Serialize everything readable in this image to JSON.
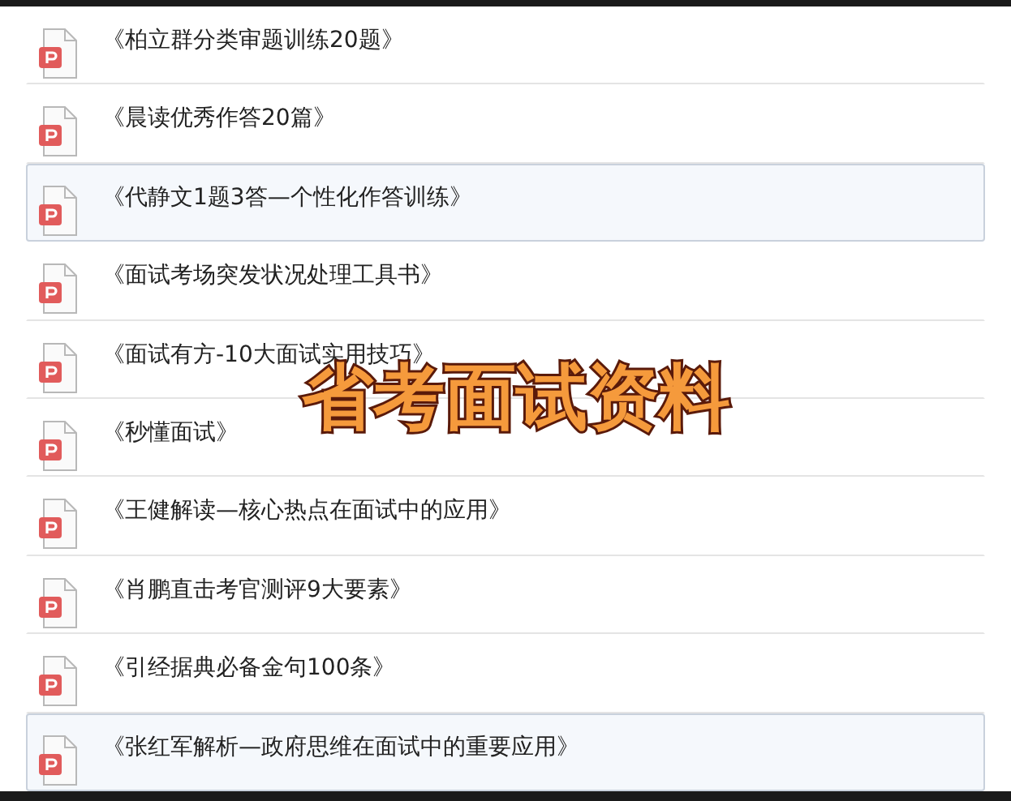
{
  "files": [
    {
      "name": "《柏立群分类审题训练20题》",
      "selected": false
    },
    {
      "name": "《晨读优秀作答20篇》",
      "selected": false
    },
    {
      "name": "《代静文1题3答—个性化作答训练》",
      "selected": true
    },
    {
      "name": "《面试考场突发状况处理工具书》",
      "selected": false
    },
    {
      "name": "《面试有方-10大面试实用技巧》",
      "selected": false
    },
    {
      "name": "《秒懂面试》",
      "selected": false
    },
    {
      "name": "《王健解读—核心热点在面试中的应用》",
      "selected": false
    },
    {
      "name": "《肖鹏直击考官测评9大要素》",
      "selected": false
    },
    {
      "name": "《引经据典必备金句100条》",
      "selected": false
    },
    {
      "name": "《张红军解析—政府思维在面试中的重要应用》",
      "selected": true
    }
  ],
  "caption": "省考面试资料"
}
